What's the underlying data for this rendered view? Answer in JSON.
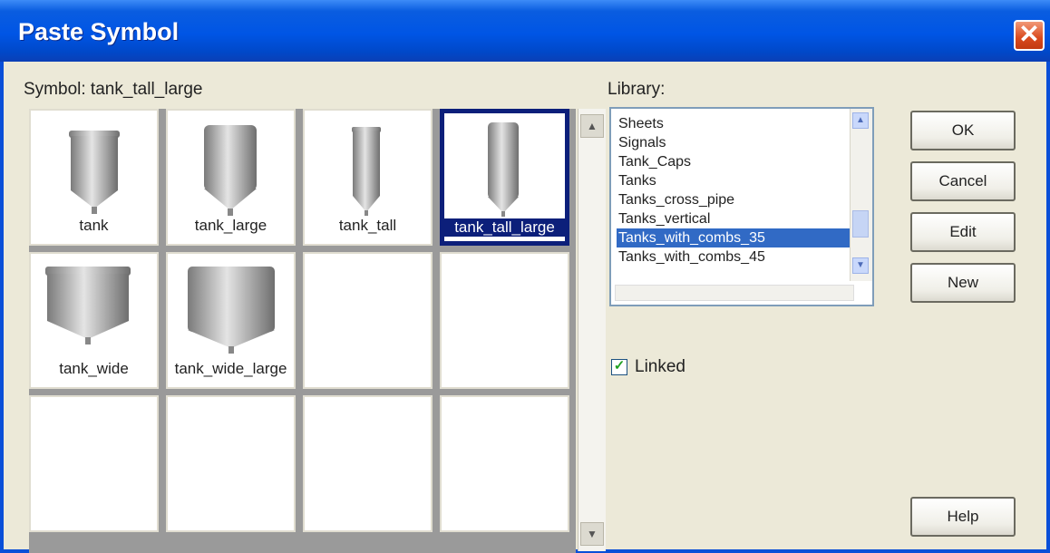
{
  "window": {
    "title": "Paste Symbol",
    "close_glyph": "✕"
  },
  "symbol_label": "Symbol: tank_tall_large",
  "category_label": "Library:",
  "symbols": [
    {
      "name": "tank",
      "icon": "tank-icon",
      "selected": false
    },
    {
      "name": "tank_large",
      "icon": "tank-large-icon",
      "selected": false
    },
    {
      "name": "tank_tall",
      "icon": "tank-tall-icon",
      "selected": false
    },
    {
      "name": "tank_tall_large",
      "icon": "tank-tall-large-icon",
      "selected": true
    },
    {
      "name": "tank_wide",
      "icon": "tank-wide-icon",
      "selected": false
    },
    {
      "name": "tank_wide_large",
      "icon": "tank-wide-large-icon",
      "selected": false
    }
  ],
  "library": {
    "items": [
      "Sheets",
      "Signals",
      "Tank_Caps",
      "Tanks",
      "Tanks_cross_pipe",
      "Tanks_vertical",
      "Tanks_with_combs_35",
      "Tanks_with_combs_45"
    ],
    "selected_index": 6
  },
  "buttons": {
    "ok": "OK",
    "cancel": "Cancel",
    "edit": "Edit",
    "new": "New",
    "help": "Help"
  },
  "linked": {
    "label": "Linked",
    "checked": true
  },
  "colors": {
    "title_blue": "#0055e5",
    "selection": "#316ac5",
    "selected_cell_border": "#0c1f7a",
    "close_red": "#d94a1e"
  }
}
